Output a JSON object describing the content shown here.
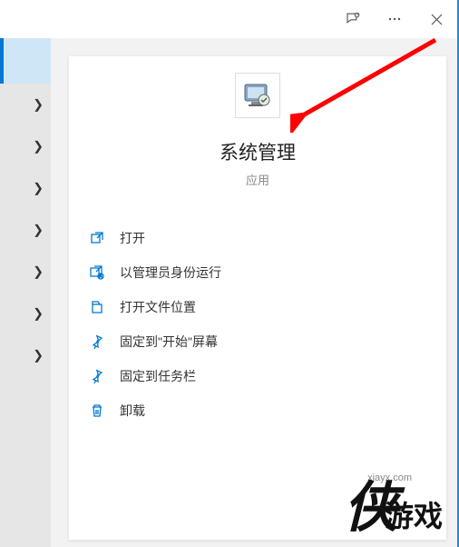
{
  "app": {
    "title": "系统管理",
    "subtitle": "应用"
  },
  "menu": [
    {
      "label": "打开",
      "icon": "open-icon"
    },
    {
      "label": "以管理员身份运行",
      "icon": "admin-icon"
    },
    {
      "label": "打开文件位置",
      "icon": "folder-icon"
    },
    {
      "label": "固定到\"开始\"屏幕",
      "icon": "pin-start-icon"
    },
    {
      "label": "固定到任务栏",
      "icon": "pin-taskbar-icon"
    },
    {
      "label": "卸载",
      "icon": "uninstall-icon"
    }
  ],
  "watermark": {
    "url": "xiayx.com",
    "brand": "侠游戏"
  }
}
